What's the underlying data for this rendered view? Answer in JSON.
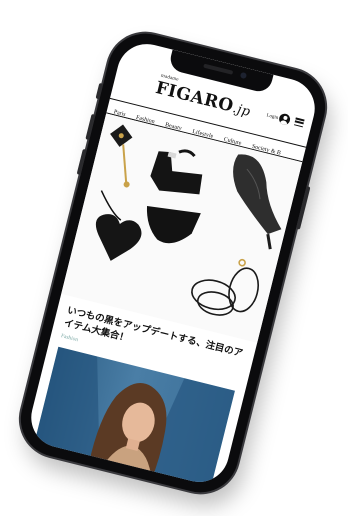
{
  "site": {
    "logo_prefix": "madame",
    "logo": "FIGARO",
    "logo_suffix": ".jp",
    "login_label": "Login"
  },
  "nav": [
    "Paris",
    "Fashion",
    "Beauty",
    "Lifestyle",
    "Culture",
    "Society & B"
  ],
  "article": {
    "headline": "いつもの黒をアップデートする、注目のアイテム大集合！",
    "category": "Fashion"
  },
  "icons": {
    "user": "user-icon",
    "menu": "hamburger-menu-icon"
  },
  "colors": {
    "category": "#7aa8a4",
    "photo_bg": "#3b6f98"
  }
}
